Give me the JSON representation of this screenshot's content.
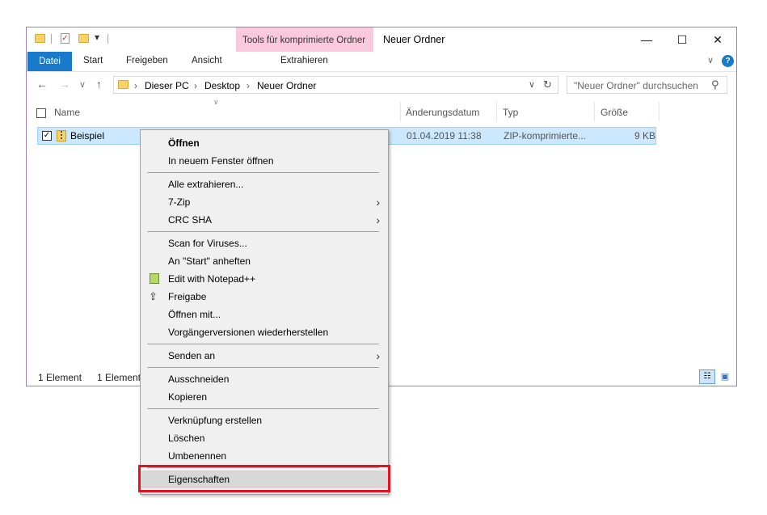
{
  "window": {
    "title": "Neuer Ordner",
    "context_tab_title": "Tools für komprimierte Ordner",
    "controls": {
      "minimize": "—",
      "maximize": "☐",
      "close": "✕"
    }
  },
  "ribbon": {
    "file_tab": "Datei",
    "tabs": [
      "Start",
      "Freigeben",
      "Ansicht"
    ],
    "context_tab": "Extrahieren"
  },
  "address": {
    "crumbs": [
      "Dieser PC",
      "Desktop",
      "Neuer Ordner"
    ],
    "search_placeholder": "\"Neuer Ordner\" durchsuchen"
  },
  "columns": {
    "name": "Name",
    "date": "Änderungsdatum",
    "type": "Typ",
    "size": "Größe"
  },
  "file": {
    "name": "Beispiel",
    "date": "01.04.2019 11:38",
    "type": "ZIP-komprimierte...",
    "size": "9 KB"
  },
  "status": {
    "count": "1 Element",
    "selected": "1 Element"
  },
  "context_menu": {
    "open": "Öffnen",
    "open_new_window": "In neuem Fenster öffnen",
    "extract_all": "Alle extrahieren...",
    "seven_zip": "7-Zip",
    "crc_sha": "CRC SHA",
    "scan": "Scan for Viruses...",
    "pin_start": "An \"Start\" anheften",
    "edit_notepad": "Edit with Notepad++",
    "share": "Freigabe",
    "open_with": "Öffnen mit...",
    "restore_versions": "Vorgängerversionen wiederherstellen",
    "send_to": "Senden an",
    "cut": "Ausschneiden",
    "copy": "Kopieren",
    "create_shortcut": "Verknüpfung erstellen",
    "delete": "Löschen",
    "rename": "Umbenennen",
    "properties": "Eigenschaften"
  },
  "colors": {
    "accent": "#1979ca",
    "highlight": "#e81123",
    "selection": "#cce8ff"
  }
}
